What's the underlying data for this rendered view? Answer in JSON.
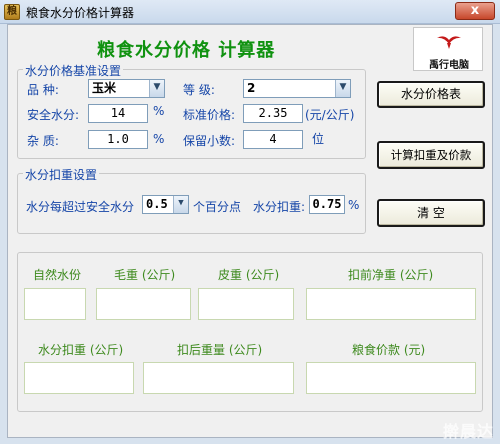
{
  "window": {
    "title": "粮食水分价格计算器",
    "close_symbol": "x"
  },
  "app": {
    "heading": "粮食水分价格  计算器"
  },
  "logo": {
    "text": "禹行电脑"
  },
  "base_settings": {
    "legend": "水分价格基准设置",
    "variety_label": "品    种:",
    "variety_value": "玉米",
    "grade_label": "等    级:",
    "grade_value": "2",
    "safe_moisture_label": "安全水分:",
    "safe_moisture_value": "14",
    "safe_moisture_unit": "%",
    "std_price_label": "标准价格:",
    "std_price_value": "2.35",
    "std_price_unit": "(元/公斤)",
    "impurity_label": "杂    质:",
    "impurity_value": "1.0",
    "impurity_unit": "%",
    "decimals_label": "保留小数:",
    "decimals_value": "4",
    "decimals_unit": "位"
  },
  "deduction_settings": {
    "legend": "水分扣重设置",
    "rule_prefix": "水分每超过安全水分",
    "step_value": "0.5",
    "rule_suffix": "个百分点",
    "deduct_label": "水分扣重:",
    "deduct_value": "0.75",
    "deduct_unit": "%"
  },
  "buttons": {
    "price_table": "水分价格表",
    "calculate": "计算扣重及价款",
    "clear": "清    空"
  },
  "results": {
    "natural_moisture_label": "自然水份",
    "gross_weight_label": "毛重 (公斤)",
    "tare_weight_label": "皮重 (公斤)",
    "net_before_label": "扣前净重 (公斤)",
    "moisture_deduct_label": "水分扣重 (公斤)",
    "weight_after_label": "扣后重量 (公斤)",
    "grain_payment_label": "粮食价款 (元)"
  },
  "watermark": {
    "text": "擀晨达"
  },
  "colors": {
    "heading_green": "#109210",
    "label_blue": "#1646a8",
    "label_green": "#3e8a1e"
  }
}
